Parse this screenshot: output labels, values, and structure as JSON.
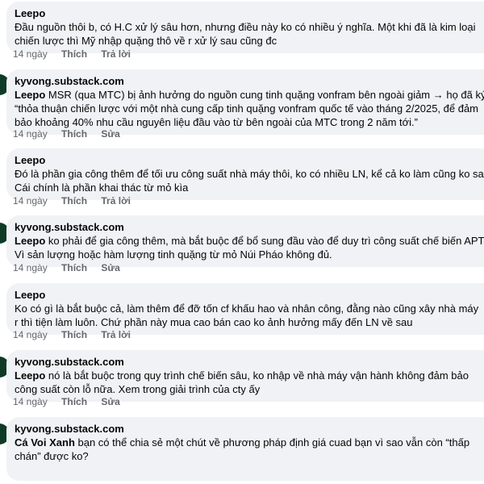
{
  "comments": [
    {
      "author": "Leepo",
      "mention": "",
      "lines": [
        "Đầu nguồn thôi b, có H.C xử lý sâu hơn, nhưng điều này ko có nhiều ý nghĩa. Một khi đã là kim loại",
        "chiến lược thì Mỹ nhập quặng thô về r xử lý sau cũng đc"
      ],
      "time": "14 ngày",
      "action1": "Thích",
      "action2": "Trả lời"
    },
    {
      "author": "kyvong.substack.com",
      "mention": "Leepo",
      "lines": [
        " MSR (qua MTC) bị ảnh hưởng do nguồn cung tinh quặng vonfram bên ngoài giảm → họ đã ký",
        "“thỏa thuận chiến lược với một nhà cung cấp tinh quặng vonfram quốc tế vào tháng 2/2025, để đảm",
        "bảo khoảng 40% nhu cầu nguyên liệu đầu vào từ bên ngoài của MTC trong 2 năm tới.”"
      ],
      "time": "14 ngày",
      "action1": "Thích",
      "action2": "Sửa"
    },
    {
      "author": "Leepo",
      "mention": "",
      "lines": [
        "Đó là phần gia công thêm để tối ưu công suất nhà máy thôi, ko có nhiều LN, kể cả ko làm cũng ko sao",
        "Cái chính là phần khai thác từ mỏ kìa"
      ],
      "time": "14 ngày",
      "action1": "Thích",
      "action2": "Trả lời"
    },
    {
      "author": "kyvong.substack.com",
      "mention": "Leepo",
      "lines": [
        " ko phải để gia công thêm, mà bắt buộc để bổ sung đầu vào để duy trì công suất chế biến APT.",
        "Vì sản lượng hoặc hàm lượng tinh quặng từ mỏ Núi Pháo không đủ."
      ],
      "time": "14 ngày",
      "action1": "Thích",
      "action2": "Sửa"
    },
    {
      "author": "Leepo",
      "mention": "",
      "lines": [
        "Ko có gì là bắt buộc cả, làm thêm để đỡ tốn cf khấu hao và nhân công, đằng nào cũng xây nhà máy",
        "r thì tiện làm luôn. Chứ phần này mua cao bán cao ko ảnh hưởng mấy đến LN về sau"
      ],
      "time": "14 ngày",
      "action1": "Thích",
      "action2": "Trả lời"
    },
    {
      "author": "kyvong.substack.com",
      "mention": "Leepo",
      "lines": [
        " nó là bắt buộc trong quy trình chế biến sâu, ko nhập về nhà máy vận hành không đảm bảo",
        "công suất còn lỗ nữa. Xem trong giải trình của cty ấy"
      ],
      "time": "14 ngày",
      "action1": "Thích",
      "action2": "Sửa"
    },
    {
      "author": "kyvong.substack.com",
      "mention": "Cá Voi Xanh",
      "lines": [
        "  bạn có thể chia sẻ một chút về phương pháp định giá cuad bạn vì sao vẫn còn “thấp",
        "chán” được ko?"
      ],
      "time": "",
      "action1": "",
      "action2": ""
    }
  ]
}
